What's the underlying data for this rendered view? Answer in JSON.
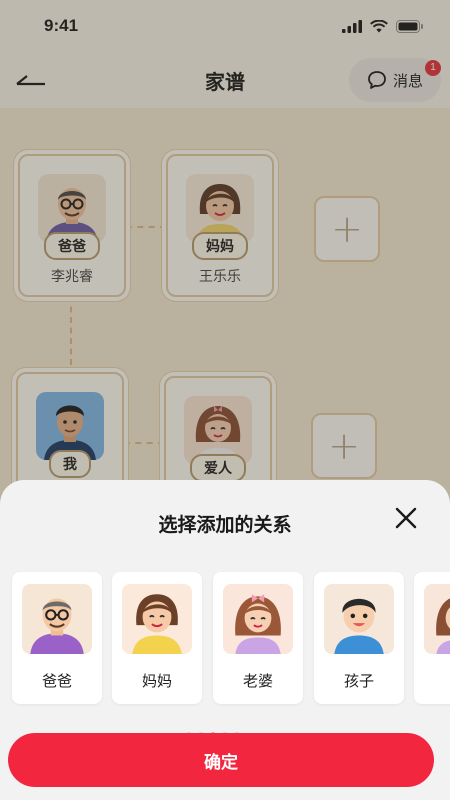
{
  "status_bar": {
    "time": "9:41"
  },
  "header": {
    "title": "家谱",
    "message_label": "消息",
    "message_badge": "1"
  },
  "tree": {
    "cards": [
      {
        "tag": "爸爸",
        "name": "李兆睿",
        "avatar": "grandpa-glasses-avatar"
      },
      {
        "tag": "妈妈",
        "name": "王乐乐",
        "avatar": "mother-avatar"
      },
      {
        "tag": "我",
        "name": "",
        "avatar": "young-man-avatar"
      },
      {
        "tag": "爱人",
        "name": "",
        "avatar": "wife-avatar"
      }
    ],
    "add_symbol": "+"
  },
  "sheet": {
    "title": "选择添加的关系",
    "options": [
      {
        "label": "爸爸",
        "avatar": "grandpa-glasses-avatar"
      },
      {
        "label": "妈妈",
        "avatar": "mother-avatar"
      },
      {
        "label": "老婆",
        "avatar": "wife-bow-avatar"
      },
      {
        "label": "孩子",
        "avatar": "boy-avatar"
      },
      {
        "label": "",
        "avatar": "partial-avatar"
      }
    ],
    "active_page_index": 2,
    "confirm_label": "确定"
  },
  "colors": {
    "accent": "#f2263f",
    "badge": "#e2323d",
    "card_border": "#e3c8a1"
  }
}
